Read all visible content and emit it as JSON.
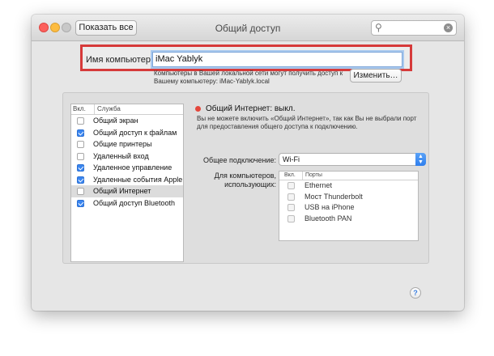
{
  "window": {
    "title": "Общий доступ",
    "show_all_label": "Показать все",
    "search": {
      "value": "",
      "placeholder": ""
    }
  },
  "computer_name": {
    "label": "Имя компьютера:",
    "value": "iMac Yablyk",
    "hint": "Компьютеры в Вашей локальной сети могут получить доступ к Вашему компьютеру: iMac-Yablyk.local",
    "change_button": "Изменить…"
  },
  "services": {
    "col_on": "Вкл.",
    "col_service": "Служба",
    "items": [
      {
        "label": "Общий экран",
        "checked": false,
        "selected": false
      },
      {
        "label": "Общий доступ к файлам",
        "checked": true,
        "selected": false
      },
      {
        "label": "Общие принтеры",
        "checked": false,
        "selected": false
      },
      {
        "label": "Удаленный вход",
        "checked": false,
        "selected": false
      },
      {
        "label": "Удаленное управление",
        "checked": true,
        "selected": false
      },
      {
        "label": "Удаленные события Apple",
        "checked": true,
        "selected": false
      },
      {
        "label": "Общий Интернет",
        "checked": false,
        "selected": true
      },
      {
        "label": "Общий доступ Bluetooth",
        "checked": true,
        "selected": false
      }
    ]
  },
  "detail": {
    "status": "Общий Интернет: выкл.",
    "status_color": "#e4473c",
    "description": "Вы не можете включить «Общий Интернет», так как Вы не выбрали порт для предоставления общего доступа к подключению.",
    "share_from_label": "Общее подключение:",
    "share_from_value": "Wi-Fi",
    "for_computers_label": "Для компьютеров, использующих:",
    "ports": {
      "col_on": "Вкл.",
      "col_ports": "Порты",
      "items": [
        {
          "label": "Ethernet",
          "checked": false
        },
        {
          "label": "Мост Thunderbolt",
          "checked": false
        },
        {
          "label": "USB на iPhone",
          "checked": false
        },
        {
          "label": "Bluetooth PAN",
          "checked": false
        }
      ]
    }
  },
  "help_label": "?",
  "colors": {
    "accent": "#3b86f0",
    "highlight_border": "#d63a3a"
  }
}
